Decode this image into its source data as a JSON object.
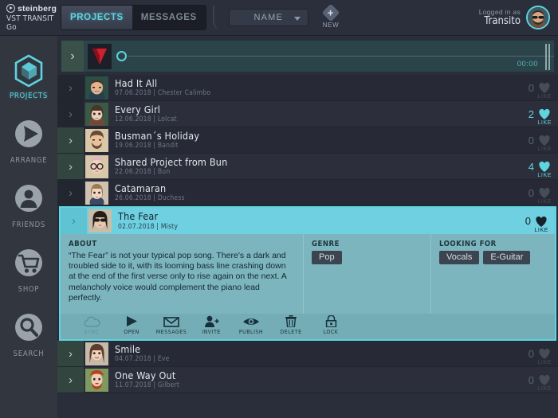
{
  "brand": {
    "name": "steinberg",
    "product": "VST TRANSIT Go",
    "logo_icon": "play-circle-icon"
  },
  "topbar": {
    "tabs": [
      {
        "label": "PROJECTS",
        "active": true
      },
      {
        "label": "MESSAGES",
        "active": false
      }
    ],
    "name_filter": {
      "value": "NAME",
      "caret_icon": "chevron-down-icon"
    },
    "new_button": {
      "label": "NEW",
      "icon": "plus-diamond-icon"
    },
    "user": {
      "logged_in_as": "Logged in as",
      "username": "Transito",
      "avatar_icon": "user-avatar"
    }
  },
  "sidebar": {
    "items": [
      {
        "label": "PROJECTS",
        "icon": "projects-cube-icon",
        "active": true
      },
      {
        "label": "ARRANGE",
        "icon": "play-circle-icon",
        "active": false
      },
      {
        "label": "FRIENDS",
        "icon": "person-circle-icon",
        "active": false
      },
      {
        "label": "SHOP",
        "icon": "shopping-cart-icon",
        "active": false
      },
      {
        "label": "SEARCH",
        "icon": "magnifier-icon",
        "active": false
      }
    ]
  },
  "player": {
    "expand_icon": "chevron-right-icon",
    "logo_icon": "vst-v-logo-icon",
    "playhead_icon": "playhead-circle-icon",
    "time": "00:00"
  },
  "projects": [
    {
      "title": "Had It All",
      "date": "07.06.2018",
      "author": "Chester Calimbo",
      "likes": "0",
      "liked": false,
      "like_label": "LIKE",
      "highlight": false
    },
    {
      "title": "Every Girl",
      "date": "12.06.2018",
      "author": "Lolcat",
      "likes": "2",
      "liked": true,
      "like_label": "LIKE",
      "highlight": false
    },
    {
      "title": "Busman´s Holiday",
      "date": "19.06.2018",
      "author": "Bandit",
      "likes": "0",
      "liked": false,
      "like_label": "LIKE",
      "highlight": true
    },
    {
      "title": "Shared Project from Bun",
      "date": "22.06.2018",
      "author": "Bun",
      "likes": "4",
      "liked": true,
      "like_label": "LIKE",
      "highlight": true
    },
    {
      "title": "Catamaran",
      "date": "26.06.2018",
      "author": "Duchess",
      "likes": "0",
      "liked": false,
      "like_label": "LIKE",
      "highlight": false
    }
  ],
  "selected_project": {
    "title": "The Fear",
    "date": "02.07.2018",
    "author": "Misty",
    "likes": "0",
    "like_label": "LIKE",
    "separator": "|",
    "about_header": "ABOUT",
    "about_text": "“The Fear” is not your typical pop song. There's a dark and troubled side to it, with its looming bass line crashing down at the end of the first verse only to rise again on the next.  A melancholy voice would complement the piano lead perfectly.",
    "genre_header": "GENRE",
    "genres": [
      "Pop"
    ],
    "looking_header": "LOOKING FOR",
    "looking_for": [
      "Vocals",
      "E-Guitar"
    ],
    "actions": [
      {
        "label": "SYNC",
        "icon": "cloud-icon",
        "disabled": true
      },
      {
        "label": "OPEN",
        "icon": "play-triangle-icon",
        "disabled": false
      },
      {
        "label": "MESSAGES",
        "icon": "envelope-icon",
        "disabled": false
      },
      {
        "label": "INVITE",
        "icon": "person-plus-icon",
        "disabled": false
      },
      {
        "label": "PUBLISH",
        "icon": "eye-icon",
        "disabled": false
      },
      {
        "label": "DELETE",
        "icon": "trash-icon",
        "disabled": false
      },
      {
        "label": "LOCK",
        "icon": "padlock-icon",
        "disabled": false
      }
    ]
  },
  "projects_after": [
    {
      "title": "Smile",
      "date": "04.07.2018",
      "author": "Eve",
      "likes": "0",
      "liked": false,
      "like_label": "LIKE",
      "highlight": true
    },
    {
      "title": "One Way Out",
      "date": "11.07.2018",
      "author": "Gilbert",
      "likes": "0",
      "liked": false,
      "like_label": "LIKE",
      "highlight": true
    }
  ],
  "colors": {
    "accent": "#5fd4e0",
    "selected_row": "#6ed0e0",
    "panel": "#7cb5be",
    "background": "#2a2d3a",
    "sidebar": "#32363f"
  }
}
